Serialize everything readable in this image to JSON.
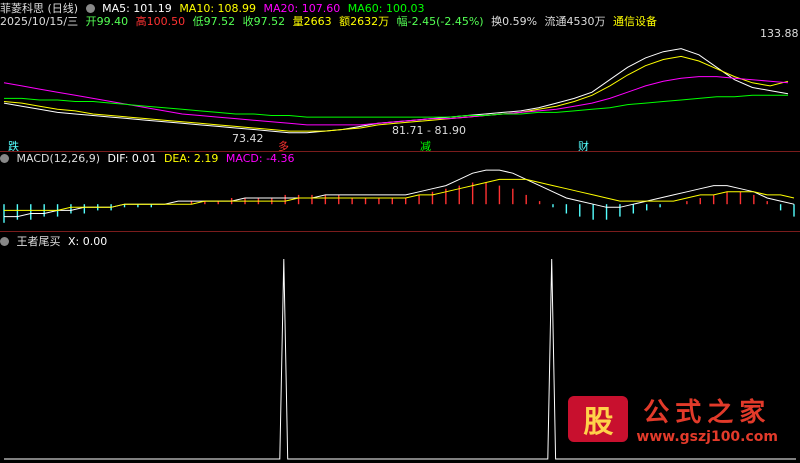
{
  "header": {
    "title": "菲菱科思 (日线)",
    "ma5": "MA5: 101.19",
    "ma10": "MA10: 108.99",
    "ma20": "MA20: 107.60",
    "ma60": "MA60: 100.03"
  },
  "quote": {
    "date": "2025/10/15/三",
    "open": "开99.40",
    "high": "高100.50",
    "low": "低97.52",
    "close": "收97.52",
    "volume": "量2663",
    "amount": "额2632万",
    "change": "幅-2.45(-2.45%)",
    "turnover": "换0.59%",
    "float": "流通4530万",
    "sector": "通信设备"
  },
  "annotations": {
    "high_label": "133.88",
    "low_label": "73.42",
    "range_label": "81.71 - 81.90",
    "signal_1": "跌",
    "signal_2": "多",
    "signal_3": "减",
    "signal_4": "财"
  },
  "macd_panel": {
    "title": "MACD(12,26,9)",
    "dif": "DIF: 0.01",
    "dea": "DEA: 2.19",
    "macd": "MACD: -4.36"
  },
  "wz_panel": {
    "title": "王者尾买",
    "x": "X: 0.00"
  },
  "watermark": {
    "logo": "股",
    "name": "公式之家",
    "url": "www.gszj100.com"
  },
  "colors": {
    "up": "#ff3232",
    "down": "#54ffff",
    "ma5": "#ffffff",
    "ma10": "#ffff00",
    "ma20": "#ff00ff",
    "ma60": "#00ff00",
    "separator": "#7a1c1c"
  },
  "chart_data": [
    {
      "type": "line",
      "panel": "price",
      "title": "菲菱科思 (日线)",
      "series": [
        {
          "name": "MA5",
          "values": [
            95,
            93,
            91,
            89,
            88,
            87,
            86,
            85,
            84,
            83,
            82,
            81,
            80,
            79,
            78,
            77,
            76,
            76,
            77,
            78,
            80,
            82,
            83,
            84,
            85,
            86,
            87,
            88,
            89,
            90,
            92,
            95,
            98,
            102,
            110,
            118,
            124,
            128,
            130,
            126,
            118,
            110,
            105,
            103,
            101
          ]
        },
        {
          "name": "MA10",
          "values": [
            96,
            95,
            93,
            91,
            90,
            88,
            87,
            86,
            85,
            84,
            83,
            82,
            81,
            80,
            79,
            78,
            77,
            77,
            77,
            78,
            79,
            81,
            82,
            83,
            84,
            85,
            86,
            87,
            88,
            89,
            91,
            93,
            96,
            100,
            106,
            113,
            119,
            123,
            125,
            122,
            117,
            112,
            108,
            106,
            109
          ]
        },
        {
          "name": "MA20",
          "values": [
            108,
            106,
            104,
            102,
            100,
            98,
            96,
            94,
            92,
            90,
            88,
            87,
            86,
            85,
            84,
            83,
            82,
            81,
            81,
            81,
            81,
            82,
            83,
            84,
            85,
            85,
            86,
            87,
            88,
            89,
            90,
            91,
            93,
            95,
            98,
            102,
            106,
            109,
            111,
            112,
            112,
            111,
            110,
            109,
            108
          ]
        },
        {
          "name": "MA60",
          "values": [
            98,
            98,
            97,
            97,
            96,
            96,
            95,
            94,
            93,
            92,
            91,
            90,
            89,
            88,
            88,
            87,
            87,
            86,
            86,
            86,
            86,
            86,
            86,
            86,
            86,
            86,
            87,
            87,
            88,
            88,
            89,
            89,
            90,
            91,
            92,
            94,
            95,
            96,
            97,
            98,
            99,
            99,
            100,
            100,
            100
          ]
        }
      ],
      "ylim": [
        70,
        140
      ],
      "high": 133.88,
      "low": 73.42
    },
    {
      "type": "bar",
      "panel": "macd",
      "title": "MACD(12,26,9)",
      "series": [
        {
          "name": "MACD",
          "values": [
            -6,
            -5,
            -5,
            -4,
            -4,
            -3,
            -3,
            -2,
            -2,
            -1,
            -1,
            -1,
            0,
            0,
            1,
            1,
            1,
            2,
            2,
            2,
            2,
            3,
            3,
            3,
            3,
            3,
            2,
            2,
            2,
            2,
            2,
            3,
            4,
            5,
            6,
            7,
            7,
            6,
            5,
            3,
            1,
            -1,
            -3,
            -4,
            -5,
            -5,
            -4,
            -3,
            -2,
            -1,
            0,
            1,
            2,
            3,
            4,
            4,
            3,
            1,
            -2,
            -4
          ]
        },
        {
          "name": "DIF",
          "values": [
            -4,
            -4,
            -3,
            -3,
            -2,
            -2,
            -1,
            -1,
            -1,
            0,
            0,
            0,
            0,
            1,
            1,
            1,
            1,
            1,
            2,
            2,
            2,
            2,
            2,
            2,
            3,
            3,
            3,
            3,
            3,
            3,
            3,
            4,
            5,
            6,
            8,
            10,
            11,
            11,
            10,
            8,
            6,
            4,
            2,
            1,
            0,
            -1,
            -1,
            0,
            1,
            2,
            3,
            4,
            5,
            6,
            6,
            5,
            4,
            2,
            1,
            0
          ]
        },
        {
          "name": "DEA",
          "values": [
            -2,
            -2,
            -2,
            -2,
            -2,
            -1,
            -1,
            -1,
            -1,
            0,
            0,
            0,
            0,
            0,
            0,
            1,
            1,
            1,
            1,
            1,
            1,
            1,
            2,
            2,
            2,
            2,
            2,
            2,
            2,
            2,
            2,
            3,
            3,
            4,
            5,
            6,
            7,
            8,
            8,
            8,
            7,
            6,
            5,
            4,
            3,
            2,
            1,
            1,
            1,
            1,
            1,
            2,
            3,
            3,
            4,
            4,
            4,
            3,
            3,
            2
          ]
        }
      ],
      "ylim": [
        -8,
        12
      ]
    },
    {
      "type": "line",
      "panel": "indicator",
      "title": "王者尾买",
      "series": [
        {
          "name": "X",
          "values": [
            0,
            0,
            0,
            0,
            0,
            0,
            0,
            0,
            0,
            0,
            0,
            0,
            0,
            0,
            0,
            0,
            0,
            0,
            0,
            0,
            0,
            0,
            0,
            0,
            0,
            0,
            0,
            0,
            0,
            0,
            0,
            0,
            0,
            0,
            0,
            0,
            0,
            0,
            0,
            0,
            0,
            0,
            0,
            0,
            0,
            0,
            0,
            0,
            0,
            0,
            0,
            0,
            0,
            0,
            0,
            0,
            0,
            0,
            0,
            0,
            0,
            0,
            0,
            0,
            0,
            0,
            0,
            0,
            0,
            0,
            0,
            1,
            0,
            0,
            0,
            0,
            0,
            0,
            0,
            0,
            0,
            0,
            0,
            0,
            0,
            0,
            0,
            0,
            0,
            0,
            0,
            0,
            0,
            0,
            0,
            0,
            0,
            0,
            0,
            0,
            0,
            0,
            0,
            0,
            0,
            0,
            0,
            0,
            0,
            0,
            0,
            0,
            0,
            0,
            0,
            0,
            0,
            0,
            0,
            0,
            0,
            0,
            0,
            0,
            0,
            0,
            0,
            0,
            0,
            0,
            0,
            0,
            0,
            0,
            0,
            0,
            0,
            0,
            0,
            1,
            0,
            0,
            0,
            0,
            0,
            0,
            0,
            0,
            0,
            0,
            0,
            0,
            0,
            0,
            0,
            0,
            0,
            0,
            0,
            0,
            0,
            0,
            0,
            0,
            0,
            0,
            0,
            0,
            0,
            0,
            0,
            0,
            0,
            0,
            0,
            0,
            0,
            0,
            0,
            0,
            0,
            0,
            0,
            0,
            0,
            0,
            0,
            0,
            0,
            0,
            0,
            0,
            0,
            0,
            0,
            0,
            0,
            0,
            0,
            0,
            0,
            0
          ]
        }
      ],
      "ylim": [
        0,
        1
      ]
    }
  ]
}
